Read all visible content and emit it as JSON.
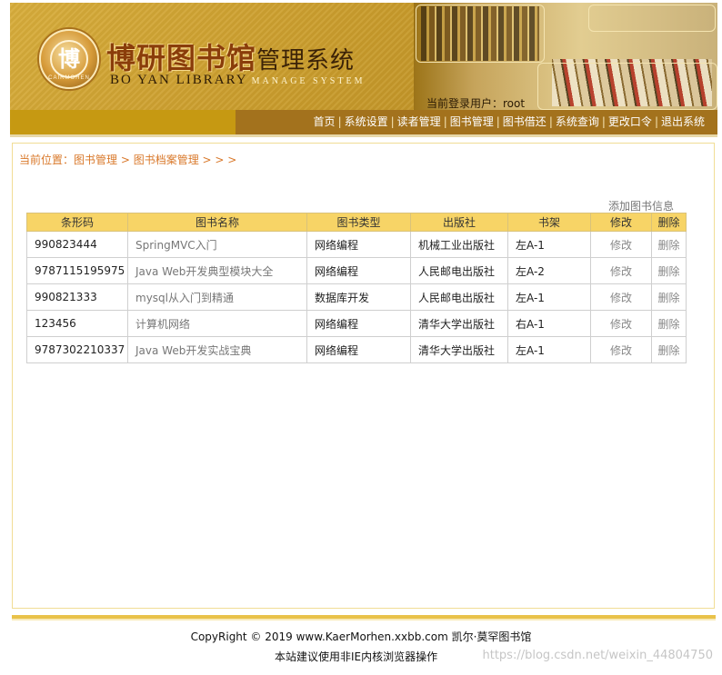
{
  "header": {
    "logo_seal_text": "博",
    "logo_seal_ring": "CAIRMOHEN",
    "logo_cn_main": "博研图书馆",
    "logo_cn_sub": "管理系统",
    "logo_en_main": "BO YAN LIBRARY",
    "logo_en_sub": "MANAGE SYSTEM",
    "login_label": "当前登录用户：root"
  },
  "nav": {
    "items": [
      {
        "label": "首页"
      },
      {
        "label": "系统设置"
      },
      {
        "label": "读者管理"
      },
      {
        "label": "图书管理"
      },
      {
        "label": "图书借还"
      },
      {
        "label": "系统查询"
      },
      {
        "label": "更改口令"
      },
      {
        "label": "退出系统"
      }
    ],
    "separator": "|"
  },
  "breadcrumb": {
    "prefix": "当前位置：",
    "level1": "图书管理",
    "arrow": " > ",
    "level2": "图书档案管理",
    "suffix": " > > >"
  },
  "actions": {
    "add_book": "添加图书信息"
  },
  "table": {
    "headers": [
      "条形码",
      "图书名称",
      "图书类型",
      "出版社",
      "书架",
      "修改",
      "删除"
    ],
    "edit_label": "修改",
    "delete_label": "删除",
    "rows": [
      {
        "barcode": "990823444",
        "name": "SpringMVC入门",
        "type": "网络编程",
        "publisher": "机械工业出版社",
        "shelf": "左A-1"
      },
      {
        "barcode": "9787115195975",
        "name": "Java Web开发典型模块大全",
        "type": "网络编程",
        "publisher": "人民邮电出版社",
        "shelf": "左A-2"
      },
      {
        "barcode": "990821333",
        "name": "mysql从入门到精通",
        "type": "数据库开发",
        "publisher": "人民邮电出版社",
        "shelf": "左A-1"
      },
      {
        "barcode": "123456",
        "name": "计算机网络",
        "type": "网络编程",
        "publisher": "清华大学出版社",
        "shelf": "右A-1"
      },
      {
        "barcode": "9787302210337",
        "name": "Java Web开发实战宝典",
        "type": "网络编程",
        "publisher": "清华大学出版社",
        "shelf": "左A-1"
      }
    ]
  },
  "footer": {
    "copyright": "CopyRight © 2019 www.KaerMorhen.xxbb.com 凯尔·莫罕图书馆",
    "browser_tip": "本站建议使用非IE内核浏览器操作",
    "watermark": "https://blog.csdn.net/weixin_44804750"
  },
  "colors": {
    "banner": "#c99c2c",
    "nav_left": "#c69912",
    "nav_right": "#a3721d",
    "table_header": "#f7d466",
    "breadcrumb": "#d9782a",
    "panel_border": "#f1dd95"
  }
}
